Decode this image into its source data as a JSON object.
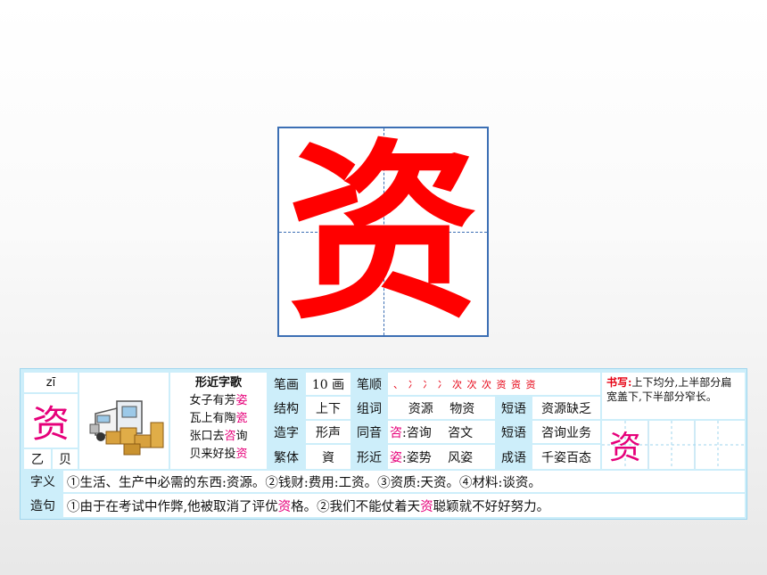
{
  "main_character": "资",
  "card": {
    "pinyin": "zī",
    "character": "资",
    "radical_label": "乙",
    "radical": "贝",
    "rhyme": {
      "title": "形近字歌",
      "lines": [
        {
          "text": "女子有芳",
          "hl": "姿"
        },
        {
          "text": "瓦上有陶",
          "hl": "瓷"
        },
        {
          "text": "张口去",
          "hl": "咨",
          "tail": "询"
        },
        {
          "text": "贝来好投",
          "hl": "资"
        }
      ]
    },
    "rows": {
      "strokes_label": "笔画",
      "strokes_value": "10 画",
      "order_label": "笔顺",
      "order_value": "、 冫 冫 冫 次 次 次 资 资 资",
      "structure_label": "结构",
      "structure_value": "上下",
      "words_label": "组词",
      "words_value": "资源　 物资",
      "phrase_label": "短语",
      "phrase1": "资源缺乏",
      "formation_label": "造字",
      "formation_value": "形声",
      "homophone_label": "同音",
      "homophone_hl": "咨",
      "homophone_text": ":咨询　 咨文",
      "phrase2": "咨询业务",
      "traditional_label": "繁体",
      "traditional_value": "資",
      "similar_label": "形近",
      "similar_hl": "姿",
      "similar_text": ":姿势　 风姿",
      "idiom_label": "成语",
      "idiom": "千姿百态"
    },
    "writing": {
      "label": "书写:",
      "text": "上下均分,上半部分扁宽盖下,下半部分窄长。",
      "sample": "资"
    },
    "meaning": {
      "label": "字义",
      "text": "①生活、生产中必需的东西:资源。②钱财:费用:工资。③资质:天资。④材料:谈资。"
    },
    "sentence": {
      "label": "造句",
      "part1": "①由于在考试中作弊,他被取消了评优",
      "hl1": "资",
      "part2": "格。②我们不能仗着天",
      "hl2": "资",
      "part3": "聪颖就不好好努力。"
    }
  }
}
